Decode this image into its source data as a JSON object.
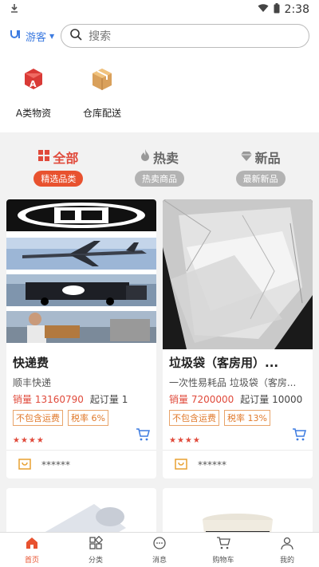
{
  "status": {
    "time": "2:38"
  },
  "header": {
    "guest_label": "游客",
    "search_placeholder": "搜索"
  },
  "shortcuts": [
    {
      "label": "A类物资",
      "icon": "a-box-icon"
    },
    {
      "label": "仓库配送",
      "icon": "package-icon"
    }
  ],
  "tabs": [
    {
      "title": "全部",
      "sub": "精选品类",
      "active": true,
      "icon": "grid-icon"
    },
    {
      "title": "热卖",
      "sub": "热卖商品",
      "active": false,
      "icon": "flame-icon"
    },
    {
      "title": "新品",
      "sub": "最新新品",
      "active": false,
      "icon": "diamond-icon"
    }
  ],
  "products": [
    {
      "title": "快递费",
      "desc": "顺丰快递",
      "sales": "销量 13160790",
      "moq": "起订量 1",
      "tag1": "不包含运费",
      "tag2": "税率 6%",
      "stars": "★★★★",
      "seller": "******"
    },
    {
      "title": "垃圾袋（客房用）...",
      "desc": "一次性易耗品 垃圾袋（客房...",
      "sales": "销量 7200000",
      "moq": "起订量 10000",
      "tag1": "不包含运费",
      "tag2": "税率 13%",
      "stars": "★★★★",
      "seller": "******"
    }
  ],
  "bottom_nav": [
    {
      "label": "首页",
      "active": true
    },
    {
      "label": "分类",
      "active": false
    },
    {
      "label": "消息",
      "active": false
    },
    {
      "label": "购物车",
      "active": false
    },
    {
      "label": "我的",
      "active": false
    }
  ],
  "colors": {
    "accent": "#e8522f",
    "brand_blue": "#3d7be0"
  }
}
